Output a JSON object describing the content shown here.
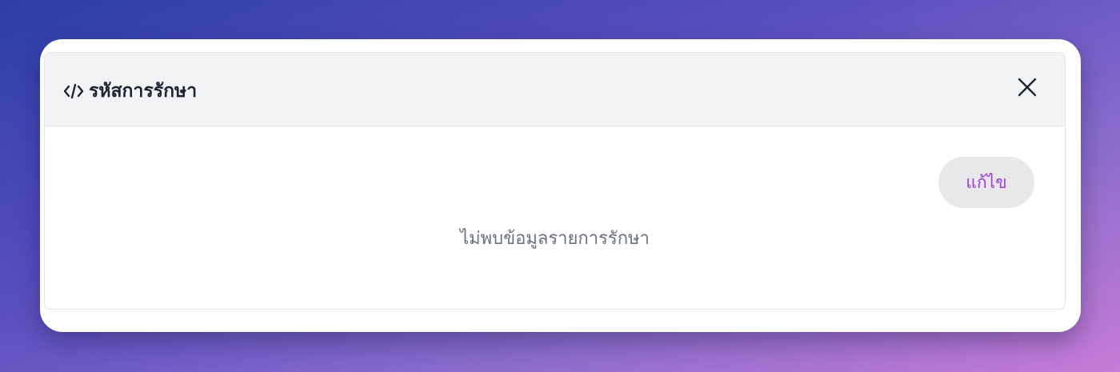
{
  "panel": {
    "title": "รหัสการรักษา",
    "title_icon": "code-icon",
    "close_icon": "close-icon",
    "edit_label": "แก้ไข",
    "empty_message": "ไม่พบข้อมูลรายการรักษา"
  },
  "colors": {
    "accent": "#9b3fd1",
    "header_bg": "#f2f3f5",
    "button_bg": "#e8e8ea",
    "empty_text": "#6b7180"
  }
}
